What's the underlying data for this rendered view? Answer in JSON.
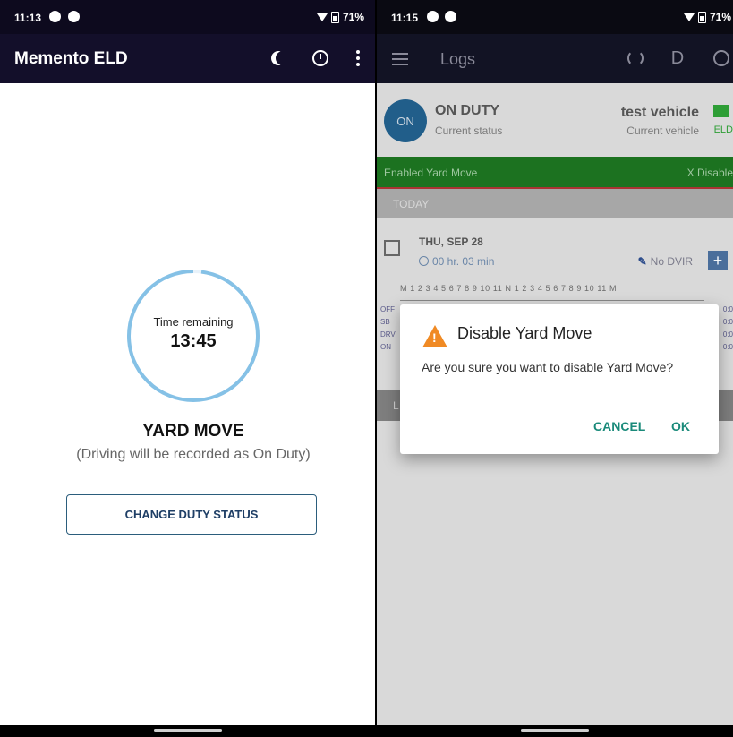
{
  "left": {
    "status_bar": {
      "time": "11:13",
      "battery": "71%"
    },
    "app_bar": {
      "title": "Memento ELD",
      "icons": [
        "moon-icon",
        "alarm-icon",
        "more-vert-icon"
      ]
    },
    "timer": {
      "label": "Time remaining",
      "value": "13:45",
      "progress_remaining": 0.98,
      "ring_color": "#85c1e6"
    },
    "status": {
      "title": "YARD MOVE",
      "subtitle": "(Driving will be recorded as On Duty)"
    },
    "change_button": "CHANGE DUTY STATUS"
  },
  "right": {
    "status_bar": {
      "time": "11:15",
      "battery": "71%"
    },
    "app_bar": {
      "title": "Logs",
      "action_letter": "D",
      "icons": [
        "menu-icon",
        "sync-icon",
        "alarm-icon"
      ]
    },
    "current_status": {
      "badge": "ON",
      "title": "ON DUTY",
      "subtitle": "Current status"
    },
    "vehicle": {
      "name": "test vehicle",
      "subtitle": "Current vehicle",
      "eld": "ELD"
    },
    "yard_move_bar": {
      "label": "Enabled Yard Move",
      "action": "X Disable"
    },
    "today_header": "TODAY",
    "log_day": {
      "date": "THU, SEP 28",
      "duration": "00 hr. 03 min",
      "dvir": "No DVIR",
      "hours": "M 1 2 3 4 5 6 7 8 9 10 11 N 1 2 3 4 5 6 7 8 9 10 11 M",
      "rows": [
        "OFF",
        "SB",
        "DRV",
        "ON"
      ],
      "row_values": [
        "0:0",
        "0:0",
        "0:0",
        "0:0"
      ]
    },
    "lower_header": "L",
    "dialog": {
      "title": "Disable Yard Move",
      "message": "Are you sure you want to disable Yard Move?",
      "cancel": "CANCEL",
      "ok": "OK"
    }
  },
  "colors": {
    "app_bar_dark": "#130f2a",
    "button_border": "#2b5d7c",
    "yard_green": "#1c7220",
    "dialog_accent": "#1a8a7a",
    "warning": "#f08a24"
  }
}
